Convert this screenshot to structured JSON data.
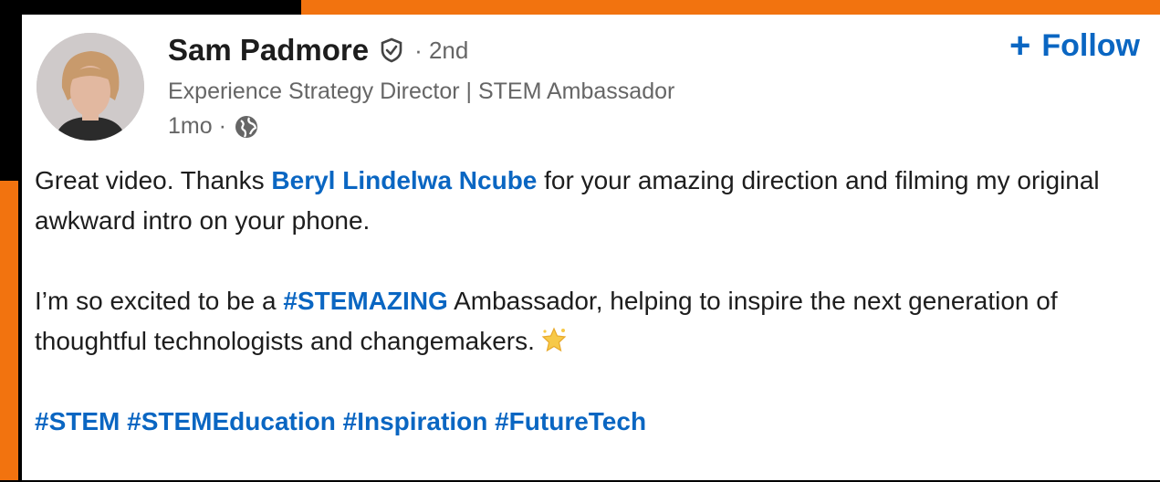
{
  "post": {
    "author": {
      "name": "Sam Padmore",
      "degree": "· 2nd",
      "headline": "Experience Strategy Director | STEM Ambassador",
      "time": "1mo ·"
    },
    "follow_label": "Follow",
    "follow_plus": "+",
    "body": {
      "p1_before": "Great video. Thanks ",
      "p1_mention": "Beryl Lindelwa Ncube",
      "p1_after": " for your amazing direction and filming my original awkward intro on your phone.",
      "p2_before": "I’m so excited to be a ",
      "p2_hashtag": "#STEMAZING",
      "p2_after": " Ambassador, helping to inspire the next generation of thoughtful technologists and changemakers.",
      "hashtags": [
        "#STEM",
        "#STEMEducation",
        "#Inspiration",
        "#FutureTech"
      ]
    }
  },
  "colors": {
    "accent": "#0a66c2",
    "frame": "#f2730f"
  },
  "icons": [
    "verified-shield-icon",
    "globe-icon",
    "sparkle-star-icon",
    "plus-icon"
  ]
}
